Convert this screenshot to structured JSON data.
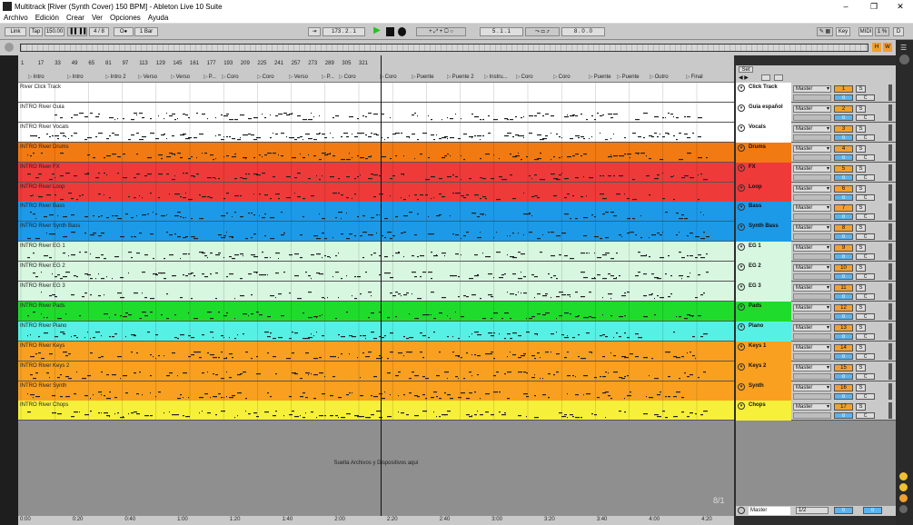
{
  "window": {
    "title": "Multitrack  [River (Synth Cover) 150 BPM] - Ableton Live 10 Suite",
    "controls": [
      "–",
      "❐",
      "✕"
    ]
  },
  "menu": [
    "Archivo",
    "Edición",
    "Crear",
    "Ver",
    "Opciones",
    "Ayuda"
  ],
  "control": {
    "link": "Link",
    "tap": "Tap",
    "tempo": "150.00",
    "sig": "4 / 8",
    "metro": "O●",
    "quant": "1 Bar",
    "position": "173 .   2 .   1",
    "loop_start": "5 .   1 .   1",
    "loop_len": "8 .   0 .   0",
    "key": "Key",
    "midi": "MIDI",
    "cpu": "1 %",
    "d": "D"
  },
  "overview": {
    "h": "H",
    "w": "W"
  },
  "ruler": {
    "bars": [
      "1",
      "17",
      "33",
      "49",
      "65",
      "81",
      "97",
      "113",
      "129",
      "145",
      "161",
      "177",
      "193",
      "209",
      "225",
      "241",
      "257",
      "273",
      "289",
      "305",
      "321"
    ],
    "locators": [
      "Intro",
      "Intro",
      "Intro 2",
      "Verso",
      "Verso",
      "P...",
      "Coro",
      "Coro",
      "Verso",
      "P...",
      "Coro",
      "Coro",
      "Puente",
      "Puente 2",
      "Instru...",
      "Coro",
      "Coro",
      "Puente",
      "Puente",
      "Outro",
      "Final"
    ]
  },
  "set_label": "Set",
  "tracks": [
    {
      "clip": "River Click Track",
      "name": "Click Track",
      "num": "1",
      "color": "#ffffff",
      "hdr": "#ffffff"
    },
    {
      "clip": "INTRO River Guia",
      "name": "Guia español",
      "num": "2",
      "color": "#ffffff",
      "hdr": "#ffffff"
    },
    {
      "clip": "INTRO River Vocals",
      "name": "Vocals",
      "num": "3",
      "color": "#ffffff",
      "hdr": "#ffffff"
    },
    {
      "clip": "INTRO River Drums",
      "name": "Drums",
      "num": "4",
      "color": "#f27a12",
      "hdr": "#f27a12"
    },
    {
      "clip": "INTRO River FX",
      "name": "FX",
      "num": "5",
      "color": "#ef3a3a",
      "hdr": "#ef3a3a"
    },
    {
      "clip": "INTRO River Loop",
      "name": "Loop",
      "num": "6",
      "color": "#ef3a3a",
      "hdr": "#ef3a3a"
    },
    {
      "clip": "INTRO River Bass",
      "name": "Bass",
      "num": "7",
      "color": "#1c9ae8",
      "hdr": "#1c9ae8"
    },
    {
      "clip": "INTRO River Synth Bass",
      "name": "Synth Bass",
      "num": "8",
      "color": "#1c9ae8",
      "hdr": "#1c9ae8"
    },
    {
      "clip": "INTRO River EG 1",
      "name": "EG 1",
      "num": "9",
      "color": "#d7f7e0",
      "hdr": "#d7f7e0"
    },
    {
      "clip": "INTRO River EG 2",
      "name": "EG 2",
      "num": "10",
      "color": "#d7f7e0",
      "hdr": "#d7f7e0"
    },
    {
      "clip": "INTRO River EG 3",
      "name": "EG 3",
      "num": "11",
      "color": "#d7f7e0",
      "hdr": "#d7f7e0"
    },
    {
      "clip": "INTRO River Pads",
      "name": "Pads",
      "num": "12",
      "color": "#1fdc2c",
      "hdr": "#1fdc2c"
    },
    {
      "clip": "INTRO River Piano",
      "name": "Piano",
      "num": "13",
      "color": "#57f0e4",
      "hdr": "#57f0e4"
    },
    {
      "clip": "INTRO River Keys",
      "name": "Keys 1",
      "num": "14",
      "color": "#f9a020",
      "hdr": "#f9a020"
    },
    {
      "clip": "INTRO River Keys 2",
      "name": "Keys 2",
      "num": "15",
      "color": "#f9a020",
      "hdr": "#f9a020"
    },
    {
      "clip": "INTRO River Synth",
      "name": "Synth",
      "num": "16",
      "color": "#f9a020",
      "hdr": "#f9a020"
    },
    {
      "clip": "INTRO River Chops",
      "name": "Chops",
      "num": "17",
      "color": "#f7f03a",
      "hdr": "#f7f03a"
    }
  ],
  "routing": "Master",
  "vol_zero": "0",
  "solo": "S",
  "center": "C",
  "drop_text": "Suelta Archivos y Dispositivos aquí",
  "timeline": [
    "0:00",
    "0:20",
    "0:40",
    "1:00",
    "1:20",
    "1:40",
    "2:00",
    "2:20",
    "2:40",
    "3:00",
    "3:20",
    "3:40",
    "4:00",
    "4:20"
  ],
  "zoom": "8/1",
  "master": {
    "name": "Master",
    "route": "1/2",
    "v1": "0",
    "v2": "0"
  }
}
